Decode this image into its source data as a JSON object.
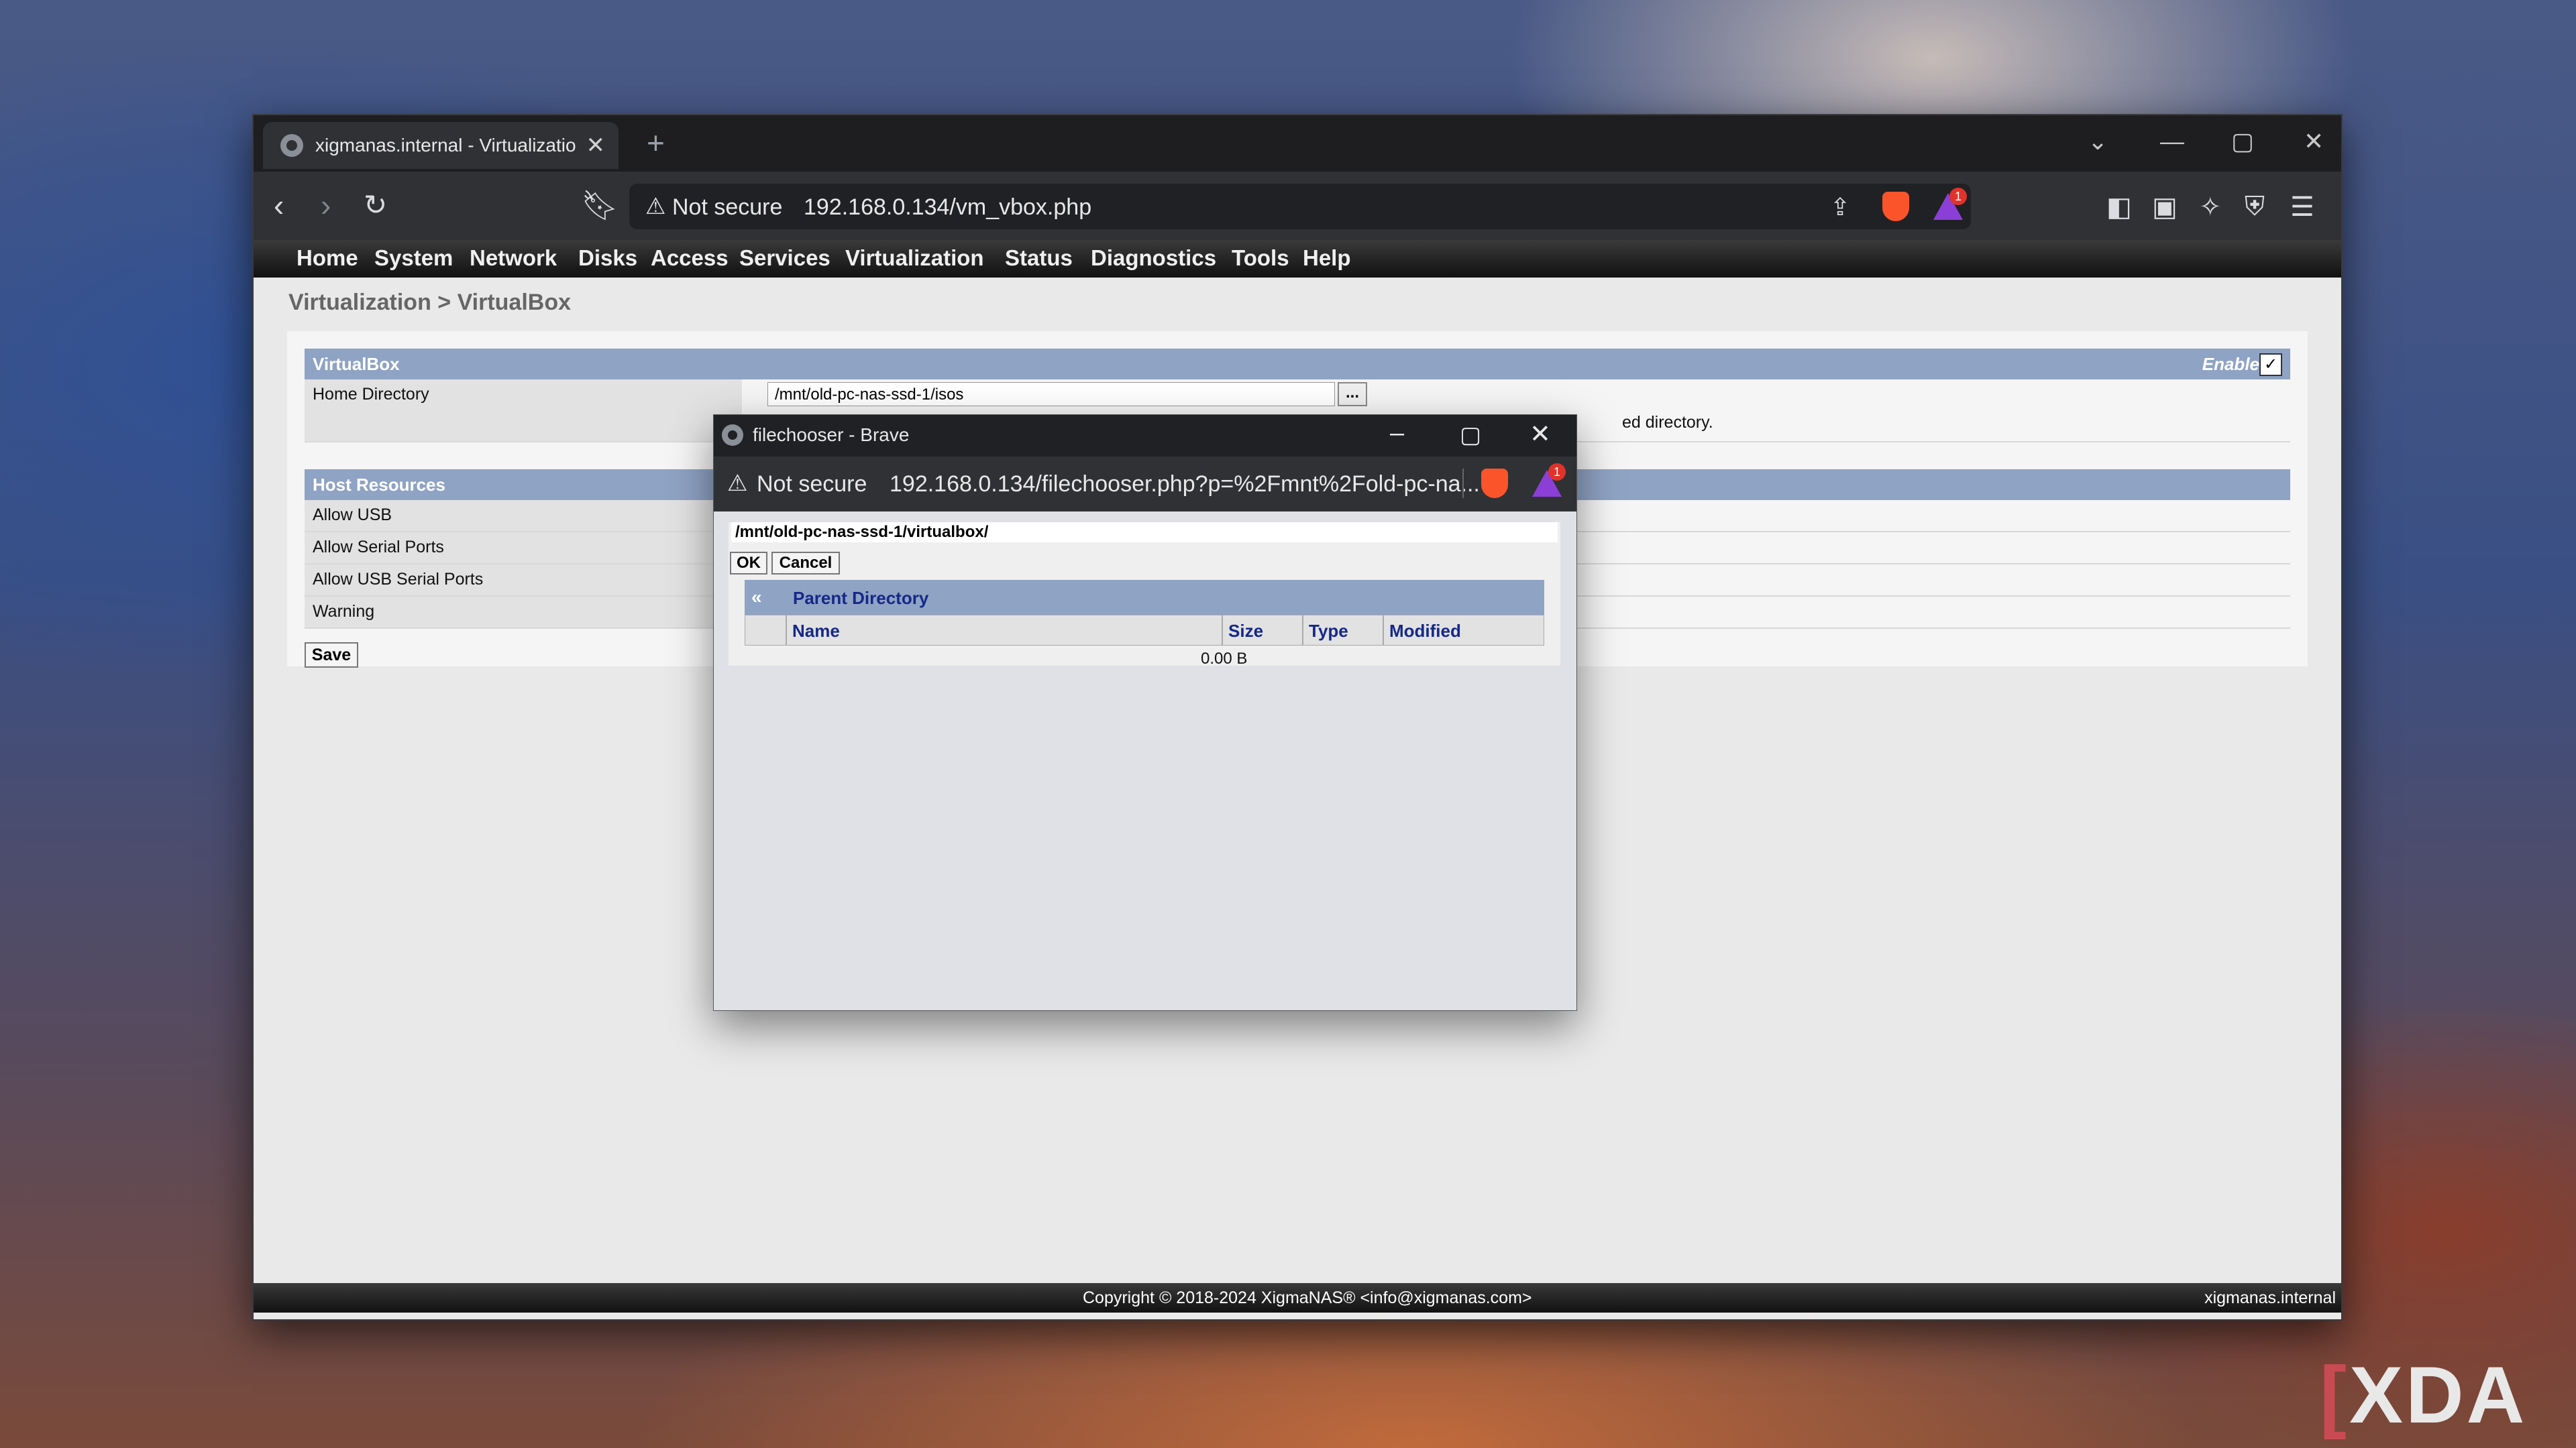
{
  "browser": {
    "tab_title": "xigmanas.internal - Virtualizatio",
    "new_tab": "+",
    "tab_close": "✕",
    "window_controls": {
      "dropdown": "⌄",
      "minimize": "—",
      "maximize": "▢",
      "close": "✕"
    },
    "security_label": "Not secure",
    "url": "192.168.0.134/vm_vbox.php",
    "badge_count": "1"
  },
  "page": {
    "menu": [
      "Home",
      "System",
      "Network",
      "Disks",
      "Access",
      "Services",
      "Virtualization",
      "Status",
      "Diagnostics",
      "Tools",
      "Help"
    ],
    "breadcrumb": "Virtualization > VirtualBox",
    "virtualbox_section": {
      "title": "VirtualBox",
      "enable_label": "Enable",
      "enabled": true,
      "home_directory_label": "Home Directory",
      "home_directory_value": "/mnt/old-pc-nas-ssd-1/isos",
      "browse_button": "...",
      "help_text": "ed directory."
    },
    "host_resources": {
      "title": "Host Resources",
      "rows": [
        "Allow USB",
        "Allow Serial Ports",
        "Allow USB Serial Ports",
        "Warning"
      ]
    },
    "save_button": "Save",
    "footer": {
      "copyright": "Copyright © 2018-2024 XigmaNAS® <info@xigmanas.com>",
      "hostname": "xigmanas.internal"
    }
  },
  "popup": {
    "window_title": "filechooser - Brave",
    "security_label": "Not secure",
    "url": "192.168.0.134/filechooser.php?p=%2Fmnt%2Fold-pc-na...",
    "badge_count": "1",
    "path_value": "/mnt/old-pc-nas-ssd-1/virtualbox/",
    "ok_button": "OK",
    "cancel_button": "Cancel",
    "parent_directory_arrow": "«",
    "parent_directory_label": "Parent Directory",
    "columns": [
      "Name",
      "Size",
      "Type",
      "Modified"
    ],
    "rows": [
      {
        "name": "",
        "size": "0.00 B",
        "type": "",
        "modified": ""
      }
    ]
  },
  "watermark": {
    "text": "XDA"
  }
}
